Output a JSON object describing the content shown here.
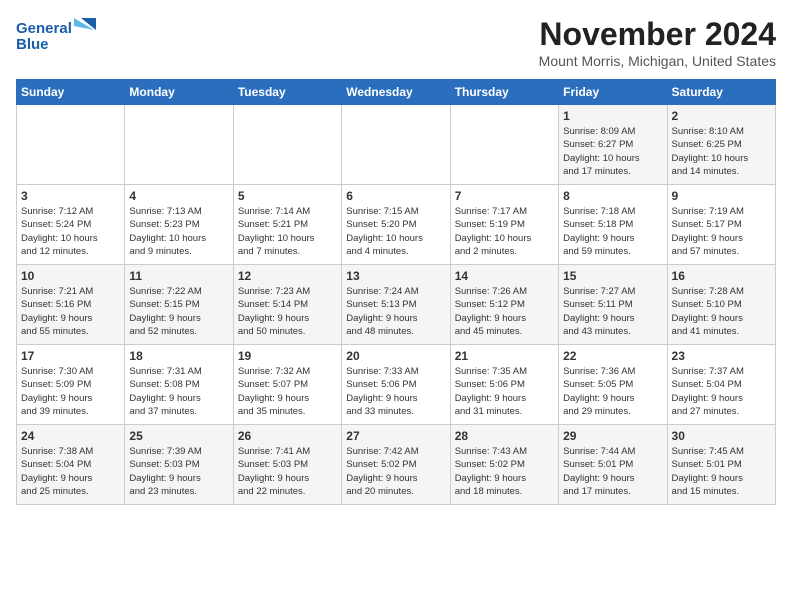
{
  "logo": {
    "line1": "General",
    "line2": "Blue"
  },
  "title": "November 2024",
  "location": "Mount Morris, Michigan, United States",
  "weekdays": [
    "Sunday",
    "Monday",
    "Tuesday",
    "Wednesday",
    "Thursday",
    "Friday",
    "Saturday"
  ],
  "weeks": [
    [
      {
        "day": "",
        "info": ""
      },
      {
        "day": "",
        "info": ""
      },
      {
        "day": "",
        "info": ""
      },
      {
        "day": "",
        "info": ""
      },
      {
        "day": "",
        "info": ""
      },
      {
        "day": "1",
        "info": "Sunrise: 8:09 AM\nSunset: 6:27 PM\nDaylight: 10 hours\nand 17 minutes."
      },
      {
        "day": "2",
        "info": "Sunrise: 8:10 AM\nSunset: 6:25 PM\nDaylight: 10 hours\nand 14 minutes."
      }
    ],
    [
      {
        "day": "3",
        "info": "Sunrise: 7:12 AM\nSunset: 5:24 PM\nDaylight: 10 hours\nand 12 minutes."
      },
      {
        "day": "4",
        "info": "Sunrise: 7:13 AM\nSunset: 5:23 PM\nDaylight: 10 hours\nand 9 minutes."
      },
      {
        "day": "5",
        "info": "Sunrise: 7:14 AM\nSunset: 5:21 PM\nDaylight: 10 hours\nand 7 minutes."
      },
      {
        "day": "6",
        "info": "Sunrise: 7:15 AM\nSunset: 5:20 PM\nDaylight: 10 hours\nand 4 minutes."
      },
      {
        "day": "7",
        "info": "Sunrise: 7:17 AM\nSunset: 5:19 PM\nDaylight: 10 hours\nand 2 minutes."
      },
      {
        "day": "8",
        "info": "Sunrise: 7:18 AM\nSunset: 5:18 PM\nDaylight: 9 hours\nand 59 minutes."
      },
      {
        "day": "9",
        "info": "Sunrise: 7:19 AM\nSunset: 5:17 PM\nDaylight: 9 hours\nand 57 minutes."
      }
    ],
    [
      {
        "day": "10",
        "info": "Sunrise: 7:21 AM\nSunset: 5:16 PM\nDaylight: 9 hours\nand 55 minutes."
      },
      {
        "day": "11",
        "info": "Sunrise: 7:22 AM\nSunset: 5:15 PM\nDaylight: 9 hours\nand 52 minutes."
      },
      {
        "day": "12",
        "info": "Sunrise: 7:23 AM\nSunset: 5:14 PM\nDaylight: 9 hours\nand 50 minutes."
      },
      {
        "day": "13",
        "info": "Sunrise: 7:24 AM\nSunset: 5:13 PM\nDaylight: 9 hours\nand 48 minutes."
      },
      {
        "day": "14",
        "info": "Sunrise: 7:26 AM\nSunset: 5:12 PM\nDaylight: 9 hours\nand 45 minutes."
      },
      {
        "day": "15",
        "info": "Sunrise: 7:27 AM\nSunset: 5:11 PM\nDaylight: 9 hours\nand 43 minutes."
      },
      {
        "day": "16",
        "info": "Sunrise: 7:28 AM\nSunset: 5:10 PM\nDaylight: 9 hours\nand 41 minutes."
      }
    ],
    [
      {
        "day": "17",
        "info": "Sunrise: 7:30 AM\nSunset: 5:09 PM\nDaylight: 9 hours\nand 39 minutes."
      },
      {
        "day": "18",
        "info": "Sunrise: 7:31 AM\nSunset: 5:08 PM\nDaylight: 9 hours\nand 37 minutes."
      },
      {
        "day": "19",
        "info": "Sunrise: 7:32 AM\nSunset: 5:07 PM\nDaylight: 9 hours\nand 35 minutes."
      },
      {
        "day": "20",
        "info": "Sunrise: 7:33 AM\nSunset: 5:06 PM\nDaylight: 9 hours\nand 33 minutes."
      },
      {
        "day": "21",
        "info": "Sunrise: 7:35 AM\nSunset: 5:06 PM\nDaylight: 9 hours\nand 31 minutes."
      },
      {
        "day": "22",
        "info": "Sunrise: 7:36 AM\nSunset: 5:05 PM\nDaylight: 9 hours\nand 29 minutes."
      },
      {
        "day": "23",
        "info": "Sunrise: 7:37 AM\nSunset: 5:04 PM\nDaylight: 9 hours\nand 27 minutes."
      }
    ],
    [
      {
        "day": "24",
        "info": "Sunrise: 7:38 AM\nSunset: 5:04 PM\nDaylight: 9 hours\nand 25 minutes."
      },
      {
        "day": "25",
        "info": "Sunrise: 7:39 AM\nSunset: 5:03 PM\nDaylight: 9 hours\nand 23 minutes."
      },
      {
        "day": "26",
        "info": "Sunrise: 7:41 AM\nSunset: 5:03 PM\nDaylight: 9 hours\nand 22 minutes."
      },
      {
        "day": "27",
        "info": "Sunrise: 7:42 AM\nSunset: 5:02 PM\nDaylight: 9 hours\nand 20 minutes."
      },
      {
        "day": "28",
        "info": "Sunrise: 7:43 AM\nSunset: 5:02 PM\nDaylight: 9 hours\nand 18 minutes."
      },
      {
        "day": "29",
        "info": "Sunrise: 7:44 AM\nSunset: 5:01 PM\nDaylight: 9 hours\nand 17 minutes."
      },
      {
        "day": "30",
        "info": "Sunrise: 7:45 AM\nSunset: 5:01 PM\nDaylight: 9 hours\nand 15 minutes."
      }
    ]
  ]
}
